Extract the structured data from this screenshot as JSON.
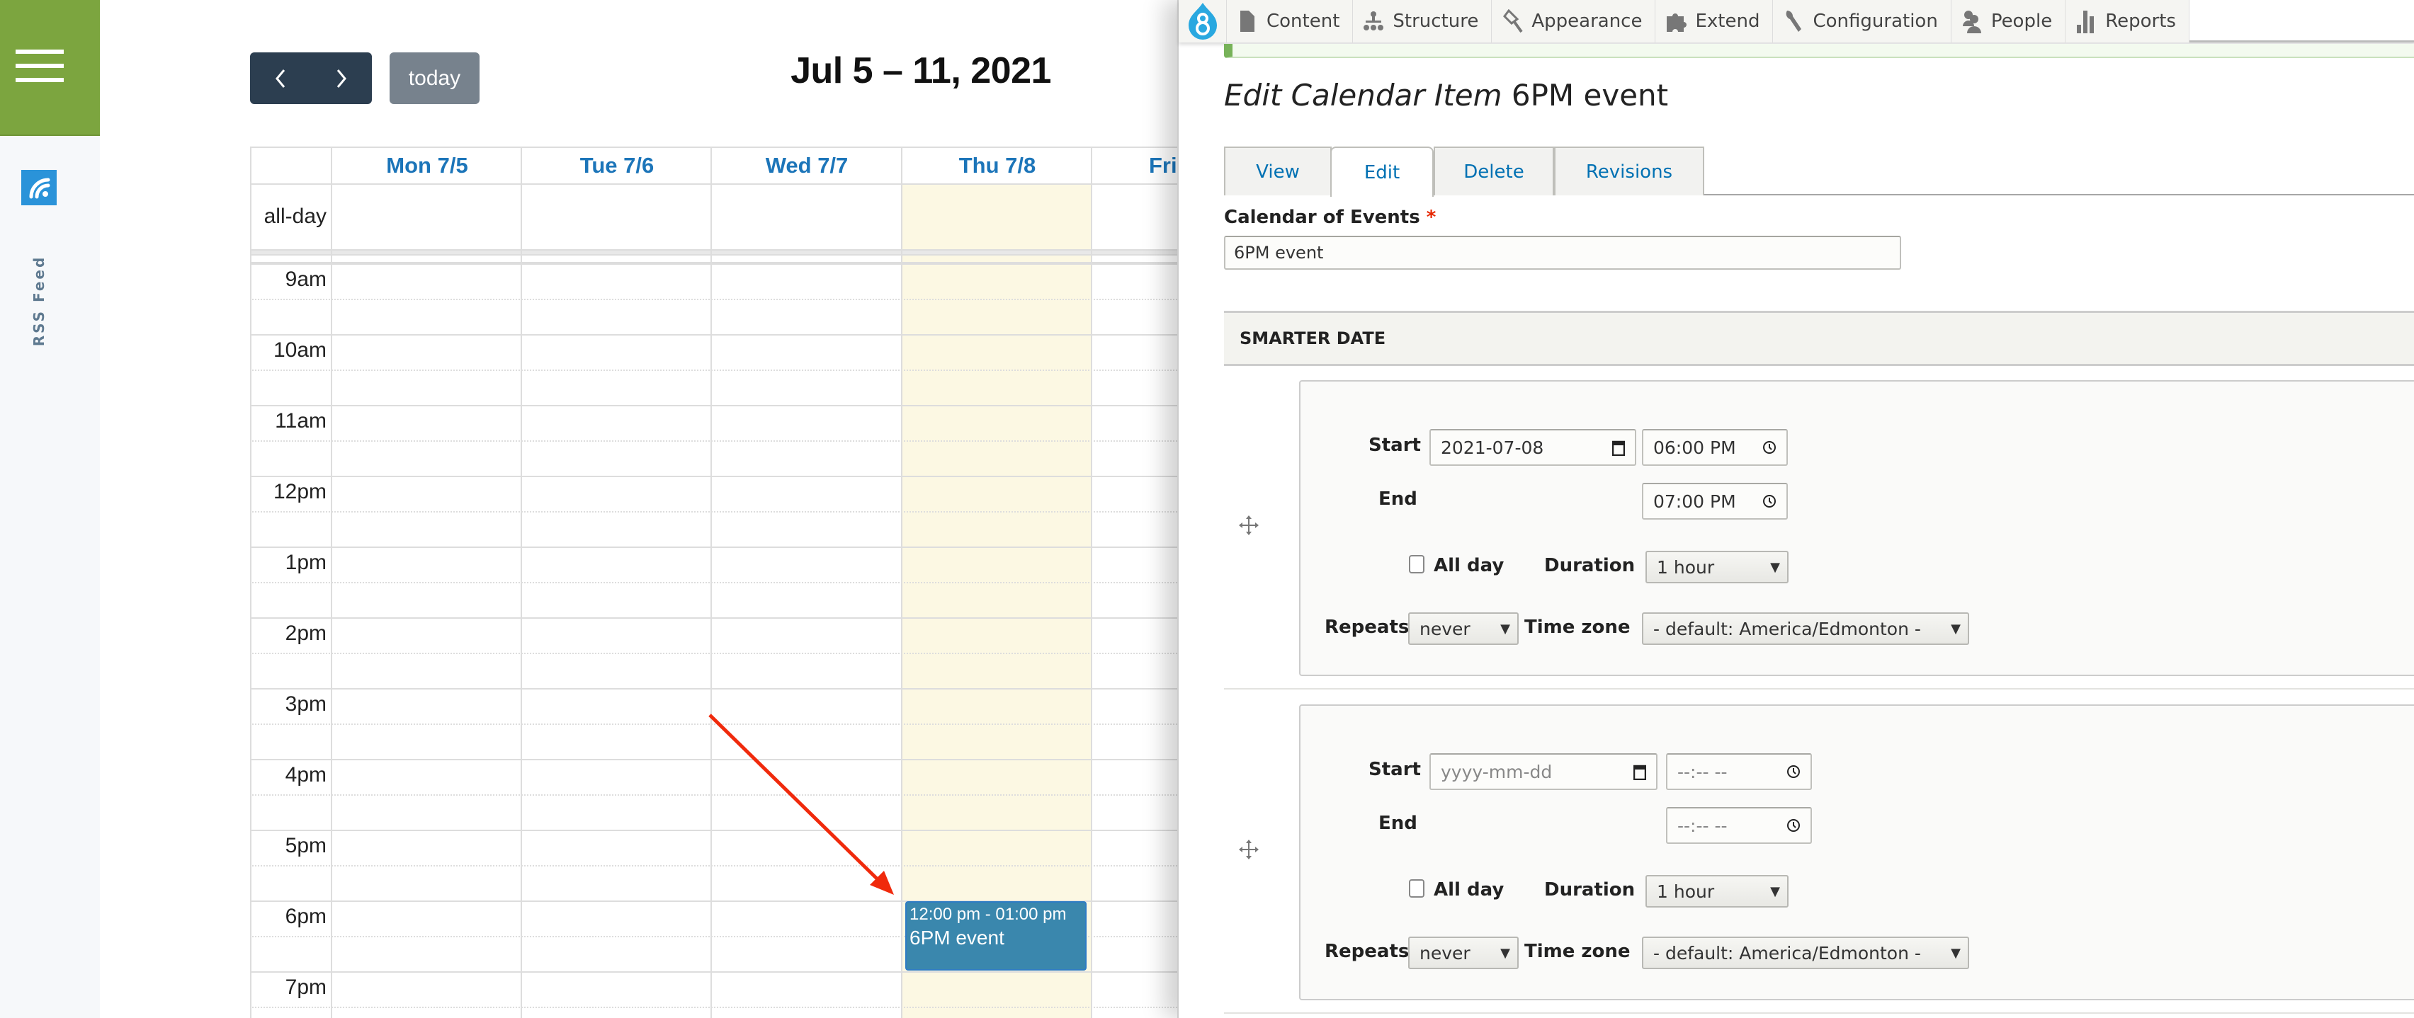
{
  "sidebar": {
    "menu_icon": "hamburger-menu-icon",
    "rss_icon": "rss-icon",
    "rss_label": "RSS Feed",
    "brand_color": "#7ca53f"
  },
  "calendar": {
    "prev_label": "‹",
    "next_label": "›",
    "today_label": "today",
    "title": "Jul 5 – 11, 2021",
    "days": [
      {
        "label": "Mon 7/5"
      },
      {
        "label": "Tue 7/6"
      },
      {
        "label": "Wed 7/7"
      },
      {
        "label": "Thu 7/8",
        "today": true
      },
      {
        "label": "Fri"
      }
    ],
    "allday_label": "all-day",
    "times": [
      "9am",
      "10am",
      "11am",
      "12pm",
      "1pm",
      "2pm",
      "3pm",
      "4pm",
      "5pm",
      "6pm",
      "7pm"
    ],
    "event": {
      "time": "12:00 pm - 01:00 pm",
      "title": "6PM event",
      "day": "Thu 7/8",
      "slot": "6pm",
      "color": "#3a87ad"
    },
    "today_highlight": "#fcf8e3"
  },
  "admin_toolbar": {
    "logo": "drupal-8-logo",
    "items": [
      {
        "label": "Content",
        "icon": "file-icon"
      },
      {
        "label": "Structure",
        "icon": "sitemap-icon"
      },
      {
        "label": "Appearance",
        "icon": "paintbrush-icon"
      },
      {
        "label": "Extend",
        "icon": "puzzle-icon"
      },
      {
        "label": "Configuration",
        "icon": "wrench-icon"
      },
      {
        "label": "People",
        "icon": "people-icon"
      },
      {
        "label": "Reports",
        "icon": "bar-chart-icon"
      }
    ]
  },
  "edit_form": {
    "title_prefix": "Edit Calendar Item",
    "title_name": "6PM event",
    "tabs": [
      {
        "label": "View",
        "active": false
      },
      {
        "label": "Edit",
        "active": true
      },
      {
        "label": "Delete",
        "active": false
      },
      {
        "label": "Revisions",
        "active": false
      }
    ],
    "title_field": {
      "label": "Calendar of Events",
      "required_mark": "*",
      "value": "6PM event"
    },
    "section_title": "SMARTER DATE",
    "labels": {
      "start": "Start",
      "end": "End",
      "all_day": "All day",
      "duration": "Duration",
      "repeats": "Repeats",
      "timezone": "Time zone"
    },
    "date_items": [
      {
        "start_date": "2021-07-08",
        "start_date_placeholder": "yyyy-mm-dd",
        "start_time": "06:00 PM",
        "end_time": "07:00 PM",
        "all_day": false,
        "duration": "1 hour",
        "repeats": "never",
        "timezone": "- default: America/Edmonton -"
      },
      {
        "start_date": "",
        "start_date_placeholder": "yyyy-mm-dd",
        "start_time": "--:-- --",
        "end_time": "--:-- --",
        "all_day": false,
        "duration": "1 hour",
        "repeats": "never",
        "timezone": "- default: America/Edmonton -"
      }
    ]
  }
}
